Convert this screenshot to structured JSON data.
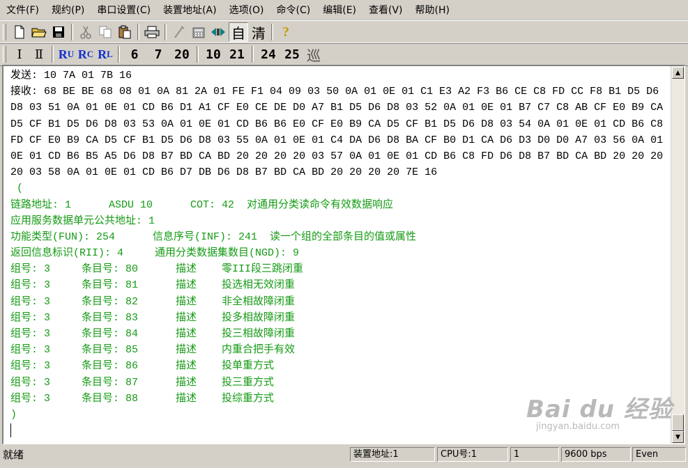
{
  "menu": [
    "文件(F)",
    "规约(P)",
    "串口设置(C)",
    "装置地址(A)",
    "选项(O)",
    "命令(C)",
    "编辑(E)",
    "查看(V)",
    "帮助(H)"
  ],
  "toolbar1": {
    "auto_label": "自",
    "clear_label": "清",
    "help_label": "?"
  },
  "toolbar2": {
    "i_label": "Ⅰ",
    "ii_label": "Ⅱ",
    "ru": {
      "main": "R",
      "sub": "U"
    },
    "rc": {
      "main": "R",
      "sub": "C"
    },
    "rl": {
      "main": "R",
      "sub": "L"
    },
    "numbers": [
      "6",
      "7",
      "20",
      "10",
      "21",
      "24",
      "25"
    ],
    "patrol_label": "巡"
  },
  "log": {
    "send_line": "发送: 10 7A 01 7B 16",
    "recv_lines": [
      "接收: 68 BE BE 68 08 01 0A 81 2A 01 FE F1 04 09 03 50 0A 01 0E 01 C1 E3 A2 F3 B6 CE C8 FD CC F8 B1 D5 D6",
      "D8 03 51 0A 01 0E 01 CD B6 D1 A1 CF E0 CE DE D0 A7 B1 D5 D6 D8 03 52 0A 01 0E 01 B7 C7 C8 AB CF E0 B9 CA",
      "D5 CF B1 D5 D6 D8 03 53 0A 01 0E 01 CD B6 B6 E0 CF E0 B9 CA D5 CF B1 D5 D6 D8 03 54 0A 01 0E 01 CD B6 C8",
      "FD CF E0 B9 CA D5 CF B1 D5 D6 D8 03 55 0A 01 0E 01 C4 DA D6 D8 BA CF B0 D1 CA D6 D3 D0 D0 A7 03 56 0A 01",
      "0E 01 CD B6 B5 A5 D6 D8 B7 BD CA BD 20 20 20 20 03 57 0A 01 0E 01 CD B6 C8 FD D6 D8 B7 BD CA BD 20 20 20",
      "20 03 58 0A 01 0E 01 CD B6 D7 DB D6 D8 B7 BD CA BD 20 20 20 20 7E 16"
    ],
    "open_paren": " (",
    "parsed": [
      "链路地址: 1      ASDU 10      COT: 42  对通用分类读命令有效数据响应",
      "应用服务数据单元公共地址: 1",
      "功能类型(FUN): 254      信息序号(INF): 241  读一个组的全部条目的值或属性",
      "返回信息标识(RII): 4     通用分类数据集数目(NGD): 9"
    ],
    "entries": [
      "组号: 3     条目号: 80      描述    零III段三跳闭重",
      "组号: 3     条目号: 81      描述    投选相无效闭重",
      "组号: 3     条目号: 82      描述    非全相故障闭重",
      "组号: 3     条目号: 83      描述    投多相故障闭重",
      "组号: 3     条目号: 84      描述    投三相故障闭重",
      "组号: 3     条目号: 85      描述    内重合把手有效",
      "组号: 3     条目号: 86      描述    投单重方式",
      "组号: 3     条目号: 87      描述    投三重方式",
      "组号: 3     条目号: 88      描述    投综重方式"
    ],
    "close_paren": ")"
  },
  "status": {
    "ready": "就绪",
    "device_address": "装置地址:1",
    "cpu": "CPU号:1",
    "channel": "1",
    "baud": "9600 bps",
    "parity": "Even"
  },
  "watermark": {
    "main": "Bai du 经验",
    "sub": "jingyan.baidu.com"
  },
  "colors": {
    "background": "#d4d0c8",
    "parsed_text": "#159a15",
    "raw_text": "#000000",
    "blue_buttons": "#1030d0"
  }
}
